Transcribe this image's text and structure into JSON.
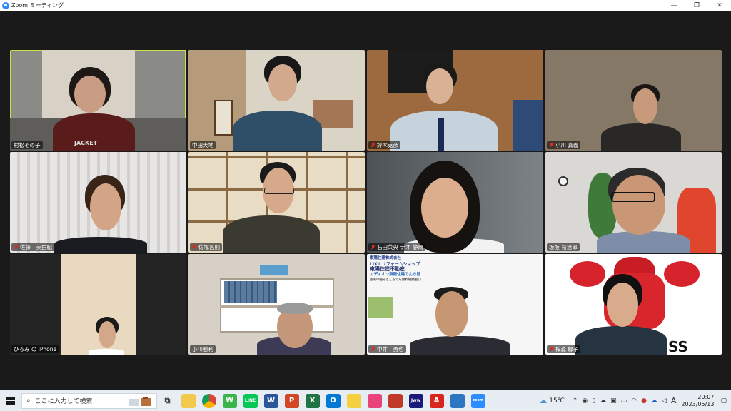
{
  "window": {
    "title": "Zoom ミーティング",
    "minimize": "—",
    "maximize": "❐",
    "close": "✕"
  },
  "participants": [
    {
      "name": "村松その子",
      "muted": false
    },
    {
      "name": "中田大地",
      "muted": false
    },
    {
      "name": "鈴木克彦",
      "muted": true
    },
    {
      "name": "小川 真義",
      "muted": true
    },
    {
      "name": "佐藤　美由紀",
      "muted": true
    },
    {
      "name": "佐塚昌則",
      "muted": true
    },
    {
      "name": "石田菜央 ナオ 静岡",
      "muted": true
    },
    {
      "name": "坂坂 裕治郎",
      "muted": false
    },
    {
      "name": "ひろみ の iPhone",
      "muted": false
    },
    {
      "name": "小川勝利",
      "muted": false
    },
    {
      "name": "中井　勇也",
      "muted": true
    },
    {
      "name": "桜森 緑子",
      "muted": true
    }
  ],
  "shirt_text": "JACKET",
  "company_panel": {
    "line1": "東陽住建株式会社",
    "line2": "LIXILリフォームショップ",
    "line3": "東陽住建不動産",
    "line4": "エディオン東陽住建でんき館",
    "line5": "住宅の悩みどころでも無料相談窓口"
  },
  "bull_text": "SS",
  "taskbar": {
    "search_placeholder": "ここに入力して検索",
    "temperature": "15℃",
    "time": "20:07",
    "date": "2023/05/13",
    "ime": "A"
  }
}
